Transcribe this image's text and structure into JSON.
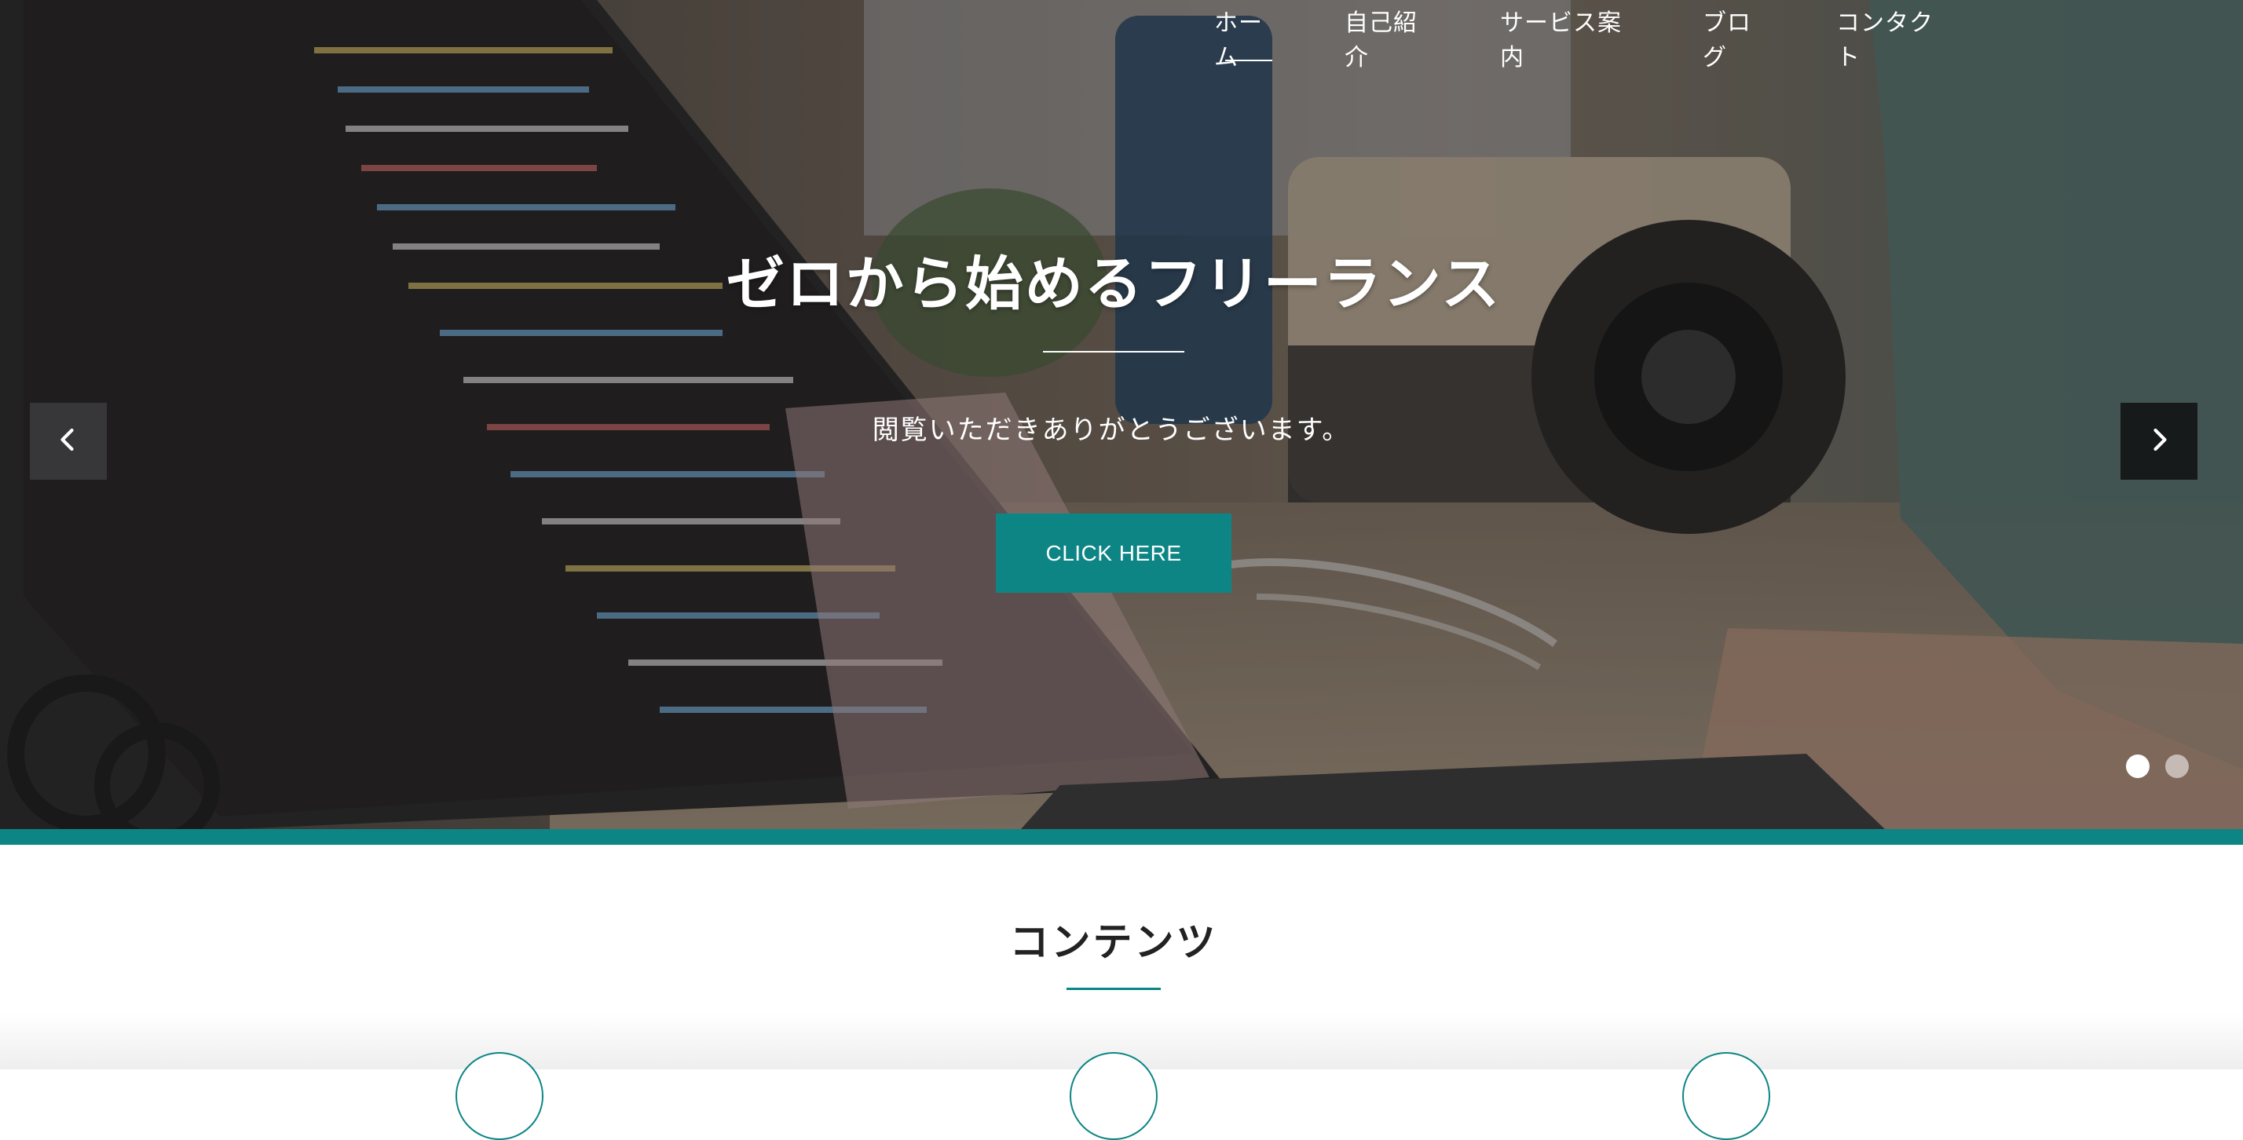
{
  "nav": {
    "items": [
      {
        "label": "ホーム",
        "active": true
      },
      {
        "label": "自己紹介",
        "active": false
      },
      {
        "label": "サービス案内",
        "active": false
      },
      {
        "label": "ブログ",
        "active": false
      },
      {
        "label": "コンタクト",
        "active": false
      }
    ]
  },
  "hero": {
    "title": "ゼロから始めるフリーランス",
    "subtitle": "閲覧いただきありがとうございます。",
    "cta_label": "CLICK HERE",
    "prev_icon": "chevron-left-icon",
    "next_icon": "chevron-right-icon",
    "slides": {
      "count": 2,
      "active_index": 0
    }
  },
  "section": {
    "title": "コンテンツ"
  },
  "colors": {
    "accent": "#0e8585",
    "text_dark": "#222222",
    "white": "#ffffff"
  }
}
